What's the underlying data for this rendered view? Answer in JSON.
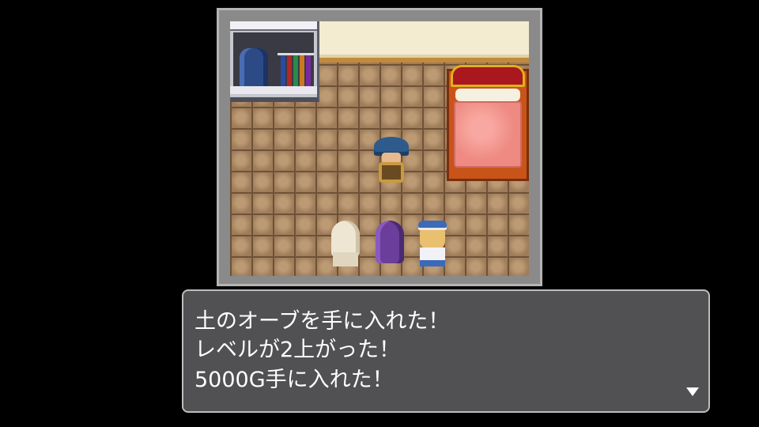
{
  "message": {
    "lines": [
      "土のオーブを手に入れた！",
      "レベルが2上がった！",
      "5000G手に入れた！"
    ],
    "continue_icon": "triangle-down-icon"
  },
  "colors": {
    "background": "#000000",
    "message_box": "#545456",
    "message_border": "#bdbdbd",
    "message_text": "#ffffff"
  }
}
